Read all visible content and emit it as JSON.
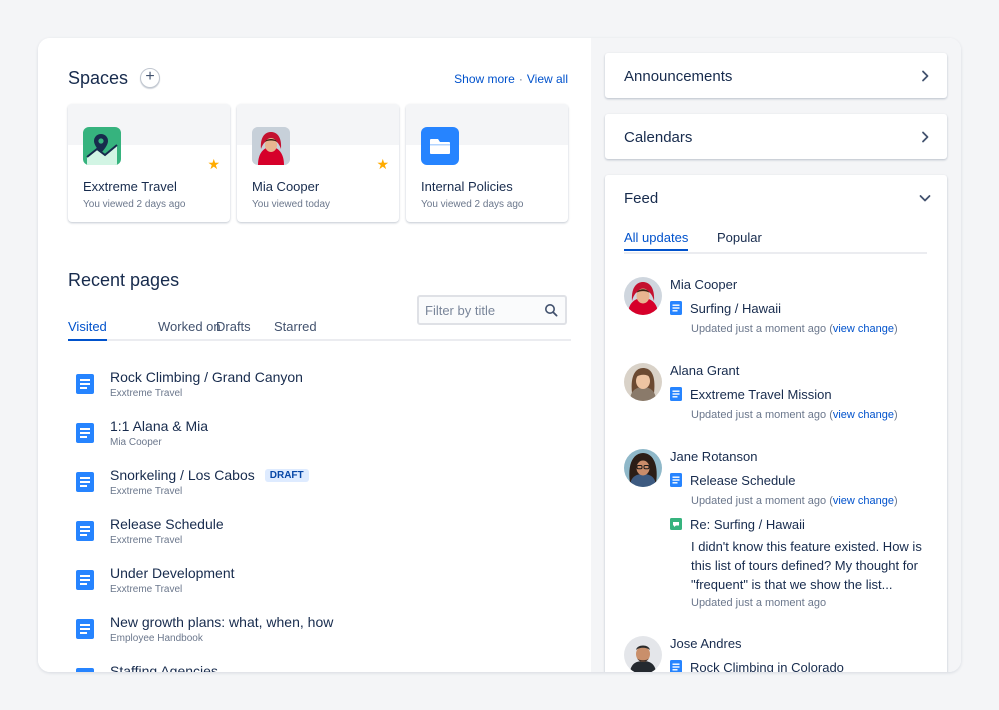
{
  "spaces": {
    "title": "Spaces",
    "add_label": "+",
    "show_more": "Show more",
    "separator": "·",
    "view_all": "View all",
    "cards": [
      {
        "name": "Exxtreme Travel",
        "meta": "You viewed 2 days ago",
        "icon": "map-pin-icon",
        "starred": true,
        "star": "★"
      },
      {
        "name": "Mia Cooper",
        "meta": "You viewed today",
        "icon": "avatar",
        "starred": true,
        "star": "★"
      },
      {
        "name": "Internal Policies",
        "meta": "You viewed 2 days ago",
        "icon": "folder-icon",
        "starred": false
      }
    ]
  },
  "recent": {
    "title": "Recent pages",
    "filter_placeholder": "Filter by title",
    "tabs": [
      "Visited",
      "Worked on",
      "Drafts",
      "Starred"
    ],
    "active_tab": "Visited",
    "pages": [
      {
        "title": "Rock Climbing / Grand Canyon",
        "space": "Exxtreme Travel"
      },
      {
        "title": "1:1 Alana & Mia",
        "space": "Mia Cooper"
      },
      {
        "title": "Snorkeling / Los Cabos",
        "space": "Exxtreme Travel",
        "badge": "DRAFT"
      },
      {
        "title": "Release Schedule",
        "space": "Exxtreme Travel"
      },
      {
        "title": "Under Development",
        "space": "Exxtreme Travel"
      },
      {
        "title": "New growth plans: what, when, how",
        "space": "Employee Handbook"
      },
      {
        "title": "Staffing Agencies",
        "space": ""
      }
    ]
  },
  "announcements": {
    "title": "Announcements"
  },
  "calendars": {
    "title": "Calendars"
  },
  "feed": {
    "title": "Feed",
    "tabs": [
      "All updates",
      "Popular"
    ],
    "active_tab": "All updates",
    "items": [
      {
        "name": "Mia Cooper",
        "page": "Surfing / Hawaii",
        "meta": "Updated just a moment ago (",
        "link": "view change",
        "meta_end": ")"
      },
      {
        "name": "Alana Grant",
        "page": "Exxtreme Travel Mission",
        "meta": "Updated just a moment ago (",
        "link": "view change",
        "meta_end": ")"
      },
      {
        "name": "Jane Rotanson",
        "page": "Release Schedule",
        "meta": "Updated just a moment ago (",
        "link": "view change",
        "meta_end": ")",
        "comment": {
          "title": "Re: Surfing / Hawaii",
          "body": "I didn't know this feature existed. How is this list of tours defined? My thought for \"frequent\" is that we show the list...",
          "meta": "Updated just a moment ago"
        }
      },
      {
        "name": "Jose Andres",
        "page": "Rock Climbing in Colorado"
      }
    ]
  },
  "colors": {
    "accent": "#0052cc",
    "star": "#ffab00",
    "space_teal": "#36b37e",
    "space_blue": "#2684ff",
    "doc_blue": "#2684ff",
    "comment_green": "#36b37e"
  }
}
